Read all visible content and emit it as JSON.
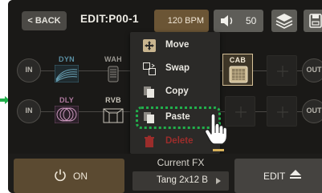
{
  "topbar": {
    "back_label": "< BACK",
    "edit_title": "EDIT:P00-1",
    "bpm_label": "120 BPM",
    "volume_value": "50"
  },
  "chain": {
    "row1": {
      "in_label": "IN",
      "out_label": "OUT",
      "fx": [
        "DYN",
        "WAH",
        "CAB"
      ]
    },
    "row2": {
      "in_label": "IN",
      "out_label": "OUT",
      "fx": [
        "DLY",
        "RVB"
      ]
    }
  },
  "menu": {
    "items": [
      {
        "label": "Move",
        "icon": "move-icon"
      },
      {
        "label": "Swap",
        "icon": "swap-icon"
      },
      {
        "label": "Copy",
        "icon": "copy-icon"
      },
      {
        "label": "Paste",
        "icon": "paste-icon"
      },
      {
        "label": "Delete",
        "icon": "trash-icon"
      }
    ]
  },
  "bottom": {
    "on_label": "ON",
    "current_fx_label": "Current FX",
    "current_fx_value": "Tang 2x12 B",
    "edit_label": "EDIT"
  },
  "colors": {
    "background": "#1a1917",
    "accent_gold": "#6b5535",
    "highlight_green": "#22b04c",
    "delete_red": "#9b2d2b",
    "dyn_blue": "#5a8fa3",
    "dly_pink": "#b07aa0",
    "cab_gold": "#d8c39a"
  }
}
